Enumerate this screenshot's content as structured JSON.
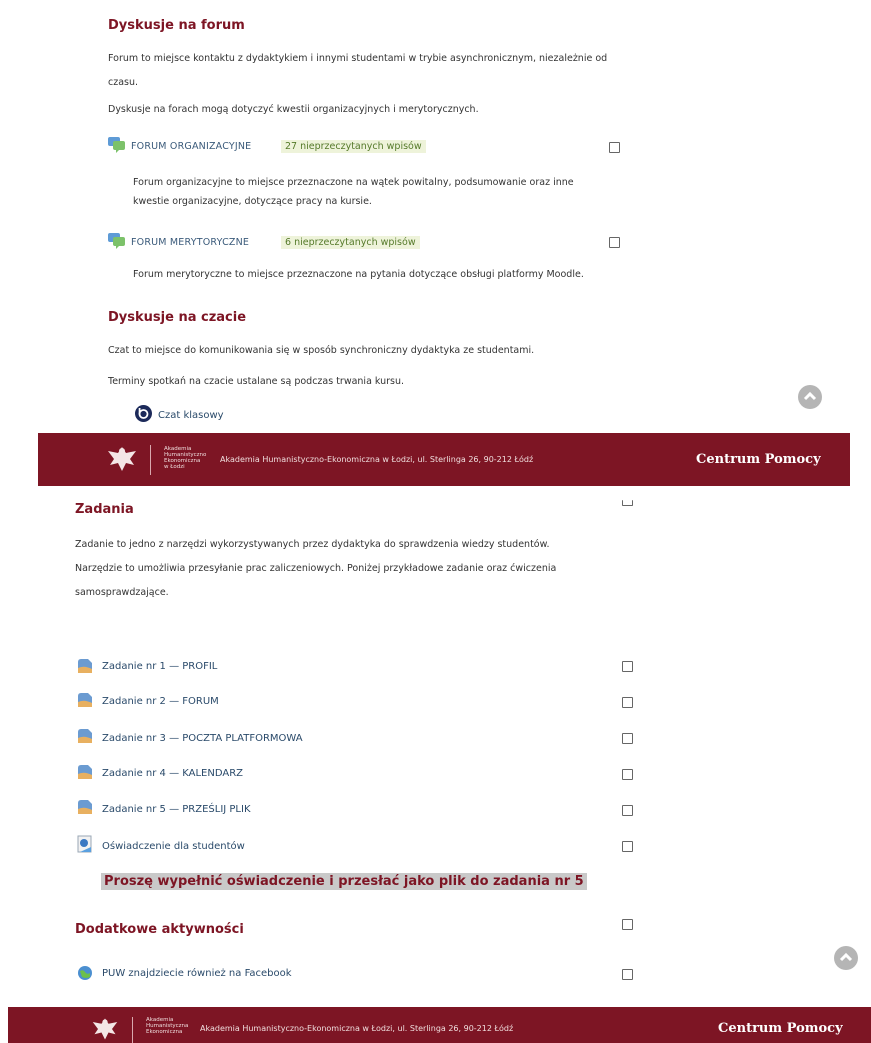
{
  "top": {
    "forum_section": {
      "heading": "Dyskusje na forum",
      "desc_line1": "Forum to miejsce kontaktu z dydaktykiem i innymi studentami w trybie asynchronicznym, niezależnie od",
      "desc_line2": "czasu.",
      "desc2": "Dyskusje na forach mogą dotyczyć kwestii organizacyjnych i merytorycznych.",
      "forums": [
        {
          "name": "FORUM ORGANIZACYJNE",
          "unread": "27 nieprzeczytanych wpisów",
          "desc_line1": "Forum organizacyjne to miejsce przeznaczone na wątek powitalny, podsumowanie oraz inne",
          "desc_line2": "kwestie organizacyjne, dotyczące pracy na kursie."
        },
        {
          "name": "FORUM MERYTORYCZNE",
          "unread": "6 nieprzeczytanych wpisów",
          "desc_line1": "Forum merytoryczne to miejsce przeznaczone na pytania dotyczące obsługi platformy Moodle."
        }
      ]
    },
    "chat_section": {
      "heading": "Dyskusje na czacie",
      "desc1": "Czat to miejsce do komunikowania się w sposób synchroniczny dydaktyka ze studentami.",
      "desc2": "Terminy spotkań na czacie ustalane są podczas trwania kursu.",
      "link": "Czat klasowy"
    }
  },
  "footer": {
    "uni_name_lines": [
      "Akademia",
      "Humanistyczno",
      "Ekonomiczna",
      "w Łodzi"
    ],
    "address": "Akademia Humanistyczno-Ekonomiczna w Łodzi, ul. Sterlinga 26, 90-212 Łódź",
    "help": "Centrum Pomocy"
  },
  "bottom": {
    "tasks": {
      "heading": "Zadania",
      "desc_line1": "Zadanie to jedno z narzędzi wykorzystywanych przez dydaktyka do sprawdzenia wiedzy studentów.",
      "desc_line2": "Narzędzie to umożliwia przesyłanie prac zaliczeniowych. Poniżej przykładowe zadanie oraz ćwiczenia",
      "desc_line3": "samosprawdzające.",
      "items": [
        "Zadanie nr 1 — PROFIL",
        "Zadanie nr 2 — FORUM",
        "Zadanie nr 3 — POCZTA PLATFORMOWA",
        "Zadanie nr 4 — KALENDARZ",
        "Zadanie nr 5 — PRZEŚLIJ PLIK"
      ],
      "declaration": "Oświadczenie dla studentów",
      "note": "Proszę wypełnić oświadczenie i przesłać jako plik do zadania nr 5"
    },
    "extra": {
      "heading": "Dodatkowe aktywności",
      "facebook": "PUW znajdziecie również na Facebook"
    }
  },
  "footer2": {
    "uni_name_lines": [
      "Akademia",
      "Humanistyczna",
      "Ekonomiczna"
    ],
    "address": "Akademia Humanistyczno-Ekonomiczna w Łodzi, ul. Sterlinga 26, 90-212 Łódź",
    "help": "Centrum Pomocy"
  },
  "colors": {
    "accent": "#7d1524",
    "link": "#2a4a6a",
    "unread_bg": "#eef3da"
  }
}
